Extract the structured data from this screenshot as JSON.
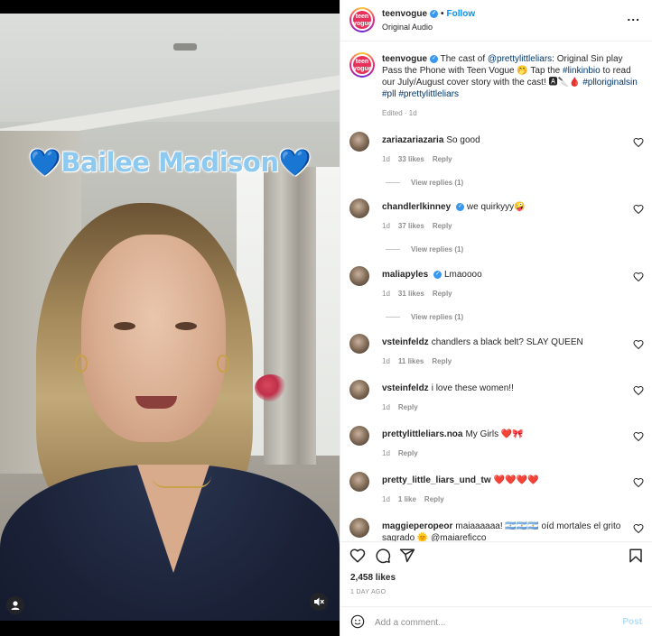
{
  "video": {
    "overlay_text": "💙Bailee Madison💙",
    "user_tag_icon": "person-icon",
    "mute_icon": "muted-speaker-icon"
  },
  "header": {
    "username": "teenvogue",
    "avatar_text": "teen vogue",
    "separator": "•",
    "follow_label": "Follow",
    "audio": "Original Audio",
    "more_label": "..."
  },
  "caption": {
    "username": "teenvogue",
    "text_1": "The cast of",
    "mention": "@prettylittleliars",
    "text_2": ": Original Sin play Pass the Phone with Teen Vogue 🤭 Tap the",
    "link": "#linkinbio",
    "text_3": "to read our July/August cover story with the cast! 🅰🔪🩸",
    "hashtags": "#plloriginalsin #pll #prettylittleliars",
    "meta": "Edited · 1d"
  },
  "comments": [
    {
      "username": "zariazariazaria",
      "text": "So good",
      "time": "1d",
      "likes": "33 likes",
      "reply": "Reply",
      "view_replies": "View replies (1)",
      "verified": false
    },
    {
      "username": "chandlerlkinney",
      "text": "we quirkyyy🤪",
      "time": "1d",
      "likes": "37 likes",
      "reply": "Reply",
      "view_replies": "View replies (1)",
      "verified": true
    },
    {
      "username": "maliapyles",
      "text": "Lmaoooo",
      "time": "1d",
      "likes": "31 likes",
      "reply": "Reply",
      "view_replies": "View replies (1)",
      "verified": true
    },
    {
      "username": "vsteinfeldz",
      "text": "chandlers a black belt? SLAY QUEEN",
      "time": "1d",
      "likes": "11 likes",
      "reply": "Reply"
    },
    {
      "username": "vsteinfeldz",
      "text": "i love these women!!",
      "time": "1d",
      "reply": "Reply"
    },
    {
      "username": "prettylittleliars.noa",
      "text": "My Girls ❤️🎀",
      "time": "1d",
      "reply": "Reply"
    },
    {
      "username": "pretty_little_liars_und_tw",
      "text": "❤️❤️❤️❤️",
      "time": "1d",
      "likes": "1 like",
      "reply": "Reply"
    },
    {
      "username": "maggieperopeor",
      "text": "maiaaaaaa! 🇦🇷🇦🇷🇦🇷 oíd mortales el grito sagrado 🌞 @maiareficco"
    }
  ],
  "actions": {
    "like_icon": "heart-icon",
    "comment_icon": "comment-bubble-icon",
    "share_icon": "paper-plane-icon",
    "save_icon": "bookmark-icon",
    "likes": "2,458 likes",
    "time_ago": "1 DAY AGO"
  },
  "add_comment": {
    "emoji_icon": "smiley-icon",
    "placeholder": "Add a comment...",
    "post_label": "Post"
  },
  "colors": {
    "accent": "#0095f6",
    "verified": "#3897f0",
    "muted_text": "#8e8e8e",
    "video_bg": "#000000"
  }
}
